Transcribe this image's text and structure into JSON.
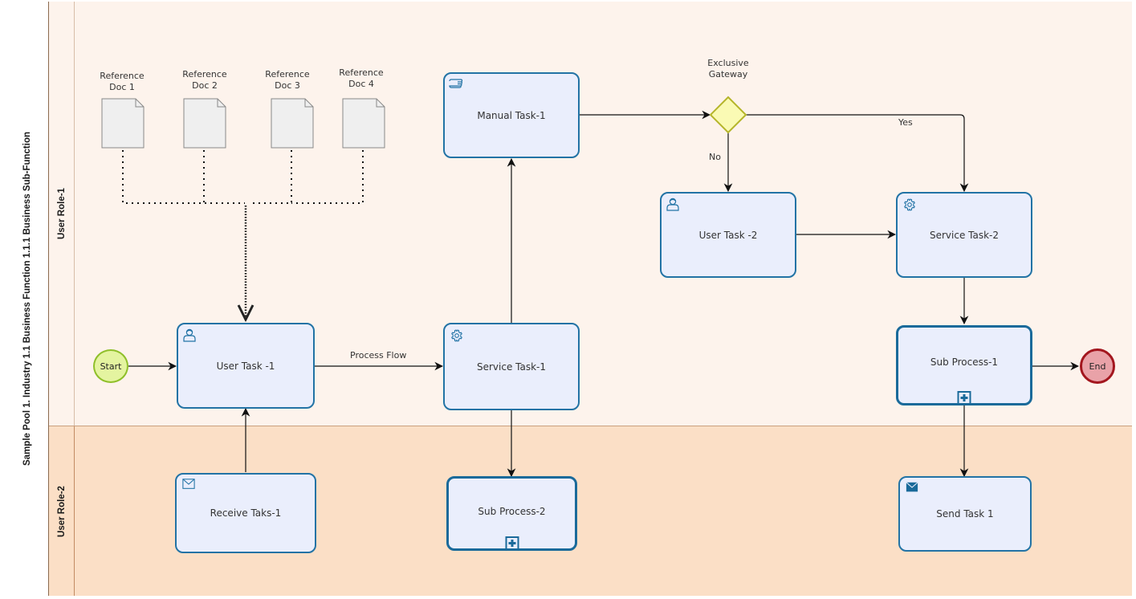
{
  "pool": {
    "title": "Sample Pool 1. Industry 1.1 Business Function 1.1.1 Business Sub-Function"
  },
  "lanes": [
    {
      "name": "User Role-1"
    },
    {
      "name": "User Role-2"
    }
  ],
  "events": {
    "start": {
      "label": "Start",
      "type": "start-event"
    },
    "end": {
      "label": "End",
      "type": "end-event"
    }
  },
  "data_objects": [
    {
      "label_line1": "Reference",
      "label_line2": "Doc 1"
    },
    {
      "label_line1": "Reference",
      "label_line2": "Doc 2"
    },
    {
      "label_line1": "Reference",
      "label_line2": "Doc 3"
    },
    {
      "label_line1": "Reference",
      "label_line2": "Doc 4"
    }
  ],
  "tasks": {
    "user_task_1": {
      "label": "User Task -1",
      "icon": "user-icon"
    },
    "manual_task_1": {
      "label": "Manual Task-1",
      "icon": "hand-icon"
    },
    "service_task_1": {
      "label": "Service Task-1",
      "icon": "gear-icon"
    },
    "user_task_2": {
      "label": "User Task -2",
      "icon": "user-icon"
    },
    "service_task_2": {
      "label": "Service Task-2",
      "icon": "gear-icon"
    },
    "sub_process_1": {
      "label": "Sub Process-1",
      "icon": "expand-plus-icon"
    },
    "receive_task_1": {
      "label": "Receive Taks-1",
      "icon": "envelope-outline-icon"
    },
    "sub_process_2": {
      "label": "Sub Process-2",
      "icon": "expand-plus-icon"
    },
    "send_task_1": {
      "label": "Send Task 1",
      "icon": "envelope-filled-icon"
    }
  },
  "gateway": {
    "label_line1": "Exclusive",
    "label_line2": "Gateway",
    "type": "exclusive"
  },
  "flow_labels": {
    "process_flow": "Process Flow",
    "yes": "Yes",
    "no": "No"
  },
  "colors": {
    "task_border": "#2273a5",
    "task_fill": "#eaeefc",
    "lane1_fill": "#fdf3ec",
    "lane2_fill": "#fbdfc6",
    "start_fill": "#e4f4a0",
    "start_border": "#8fbf2a",
    "end_fill": "#e9a2a8",
    "end_border": "#a3161e",
    "gateway_fill": "#fafab4",
    "gateway_border": "#b5b52a"
  }
}
